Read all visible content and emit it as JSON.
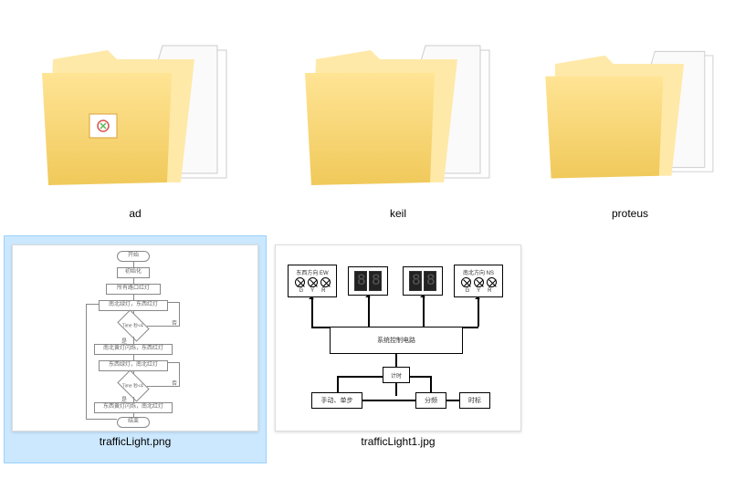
{
  "items": [
    {
      "type": "folder",
      "name": "ad",
      "has_overlay_icon": true,
      "selected": false
    },
    {
      "type": "folder",
      "name": "keil",
      "has_overlay_icon": false,
      "selected": false
    },
    {
      "type": "folder",
      "name": "proteus",
      "has_overlay_icon": false,
      "selected": false
    },
    {
      "type": "image",
      "name": "trafficLight.png",
      "thumb_kind": "flowchart",
      "selected": true
    },
    {
      "type": "image",
      "name": "trafficLight1.jpg",
      "thumb_kind": "blockdiagram",
      "selected": false
    }
  ],
  "flowchart": {
    "steps": [
      "开始",
      "初始化",
      "所有路口红灯",
      "南北绿灯，东西红灯",
      "Time 秒<4",
      "南北黄灯闪烁，东西红灯",
      "东西绿灯，南北红灯",
      "Time 秒<4",
      "东西黄灯闪烁，南北红灯",
      "结束"
    ],
    "branch_labels": [
      "否",
      "是",
      "否",
      "是"
    ]
  },
  "blockdiagram": {
    "left_box": "东西方向  EW",
    "right_box": "南北方向  NS",
    "light_labels": [
      "G",
      "Y",
      "R"
    ],
    "center": "系统控制电路",
    "mid_small": "计时",
    "bottom": [
      "手动、单步",
      "分频",
      "时标"
    ]
  }
}
